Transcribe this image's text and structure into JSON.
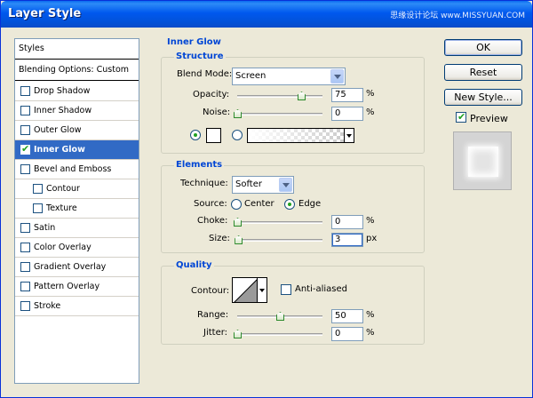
{
  "window": {
    "title": "Layer Style",
    "watermark": "思缘设计论坛 www.MISSYUAN.COM"
  },
  "styles_list": {
    "header": "Styles",
    "blending": "Blending Options: Custom",
    "items": [
      {
        "label": "Drop Shadow",
        "checked": false
      },
      {
        "label": "Inner Shadow",
        "checked": false
      },
      {
        "label": "Outer Glow",
        "checked": false
      },
      {
        "label": "Inner Glow",
        "checked": true
      },
      {
        "label": "Bevel and Emboss",
        "checked": false
      },
      {
        "label": "Contour",
        "checked": false
      },
      {
        "label": "Texture",
        "checked": false
      },
      {
        "label": "Satin",
        "checked": false
      },
      {
        "label": "Color Overlay",
        "checked": false
      },
      {
        "label": "Gradient Overlay",
        "checked": false
      },
      {
        "label": "Pattern Overlay",
        "checked": false
      },
      {
        "label": "Stroke",
        "checked": false
      }
    ]
  },
  "panel": {
    "title": "Inner Glow",
    "structure": {
      "title": "Structure",
      "blend_mode_label": "Blend Mode:",
      "blend_mode_value": "Screen",
      "opacity_label": "Opacity:",
      "opacity_value": "75",
      "opacity_level": 0.75,
      "opacity_unit": "%",
      "noise_label": "Noise:",
      "noise_value": "0",
      "noise_level": 0,
      "noise_unit": "%",
      "color_swatch": "#ffffff"
    },
    "elements": {
      "title": "Elements",
      "technique_label": "Technique:",
      "technique_value": "Softer",
      "source_label": "Source:",
      "source_center": "Center",
      "source_edge": "Edge",
      "choke_label": "Choke:",
      "choke_value": "0",
      "choke_level": 0,
      "choke_unit": "%",
      "size_label": "Size:",
      "size_value": "3",
      "size_level": 0.012,
      "size_unit": "px"
    },
    "quality": {
      "title": "Quality",
      "contour_label": "Contour:",
      "anti_aliased_label": "Anti-aliased",
      "range_label": "Range:",
      "range_value": "50",
      "range_level": 0.5,
      "range_unit": "%",
      "jitter_label": "Jitter:",
      "jitter_value": "0",
      "jitter_level": 0,
      "jitter_unit": "%"
    }
  },
  "buttons": {
    "ok": "OK",
    "reset": "Reset",
    "new_style": "New Style...",
    "preview": "Preview"
  },
  "colors": {
    "accent": "#316ac5",
    "title_blue": "#0046d5",
    "check_green": "#21a121"
  }
}
